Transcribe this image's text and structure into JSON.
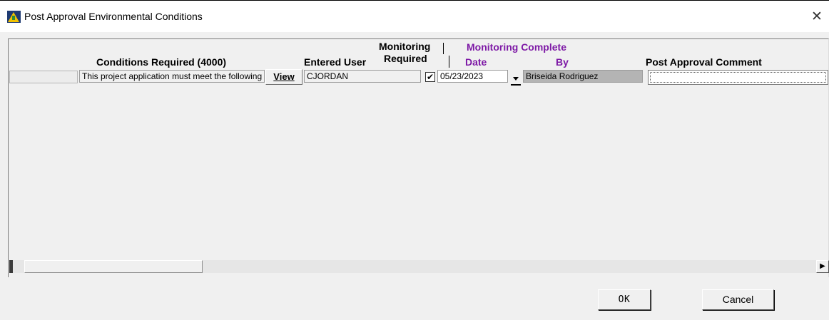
{
  "window": {
    "title": "Post Approval Environmental Conditions",
    "close_glyph": "✕"
  },
  "grid": {
    "headers": {
      "conditions": "Conditions Required (4000)",
      "entered_user": "Entered User",
      "monitoring_line1": "Monitoring",
      "monitoring_line2": "Required",
      "monitoring_complete": "Monitoring Complete",
      "date": "Date",
      "by": "By",
      "comment": "Post Approval Comment"
    },
    "rows": [
      {
        "condition": "This project application must meet the following",
        "view_label": "View",
        "entered_user": "CJORDAN",
        "monitoring_required": true,
        "check_glyph": "✔",
        "date": "05/23/2023",
        "by": "Briseida  Rodriguez",
        "comment": ""
      }
    ]
  },
  "scrollbar": {
    "left_arrow": "◀",
    "right_arrow": "▶"
  },
  "buttons": {
    "ok": "OK",
    "cancel": "Cancel"
  },
  "colors": {
    "accent_purple": "#7e1aa6",
    "window_bg": "#f0f0f0"
  },
  "icons": {
    "app": "app-logo-icon",
    "close": "close-icon",
    "dropdown": "dropdown-arrow-icon",
    "scroll_left": "scroll-left-icon",
    "scroll_right": "scroll-right-icon"
  }
}
